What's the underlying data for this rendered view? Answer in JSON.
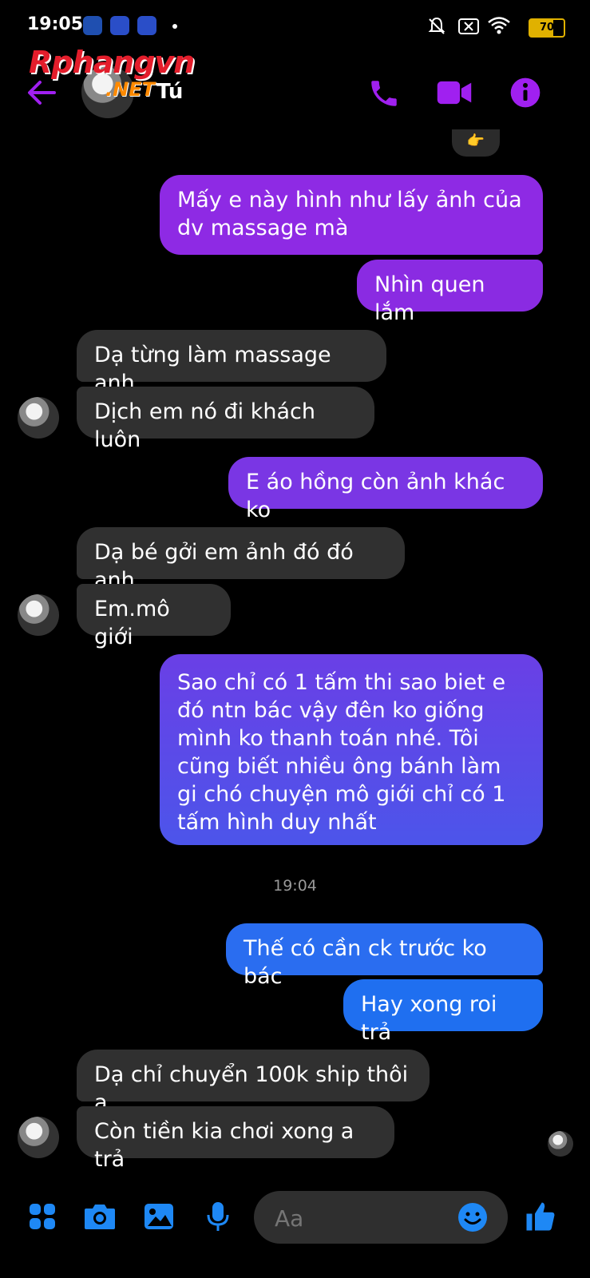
{
  "status_bar": {
    "time": "19:05",
    "battery": "70"
  },
  "watermark": {
    "brand": "Rphangvn",
    "suffix": ".NET"
  },
  "header": {
    "contact_name": "Tú"
  },
  "reaction": {
    "emoji": "👉"
  },
  "messages": [
    {
      "side": "out",
      "text": "Mấy e này hình như lấy ảnh của dv massage mà"
    },
    {
      "side": "out",
      "text": "Nhìn quen lắm"
    },
    {
      "side": "in",
      "text": "Dạ từng làm massage anh"
    },
    {
      "side": "in",
      "text": "Dịch em nó đi khách luôn"
    },
    {
      "side": "out",
      "text": "E áo hồng còn ảnh khác ko"
    },
    {
      "side": "in",
      "text": "Dạ bé gởi em ảnh đó đó anh"
    },
    {
      "side": "in",
      "text": "Em.mô giới"
    },
    {
      "side": "out",
      "text": "Sao chỉ có 1 tấm thi sao biet e đó ntn bác vậy đên ko giống mình ko thanh toán nhé. Tôi cũng biết nhiều ông bánh làm gi chó chuyện mô giới chỉ có 1 tấm hình duy nhất"
    },
    {
      "side": "out",
      "text": "Thế có cần ck trước ko bác"
    },
    {
      "side": "out",
      "text": "Hay xong roi trả"
    },
    {
      "side": "in",
      "text": "Dạ chỉ chuyển 100k ship thôi a"
    },
    {
      "side": "in",
      "text": "Còn tiền kia chơi xong a trả"
    }
  ],
  "timestamp": "19:04",
  "composer": {
    "placeholder": "Aa"
  },
  "colors": {
    "accent": "#a020f0",
    "outgoing_top": "#8a2be2",
    "outgoing_mid": "#5a4fe8",
    "outgoing_bottom": "#1f6ff0",
    "incoming": "#303030",
    "composer_icons": "#1e88f5"
  }
}
